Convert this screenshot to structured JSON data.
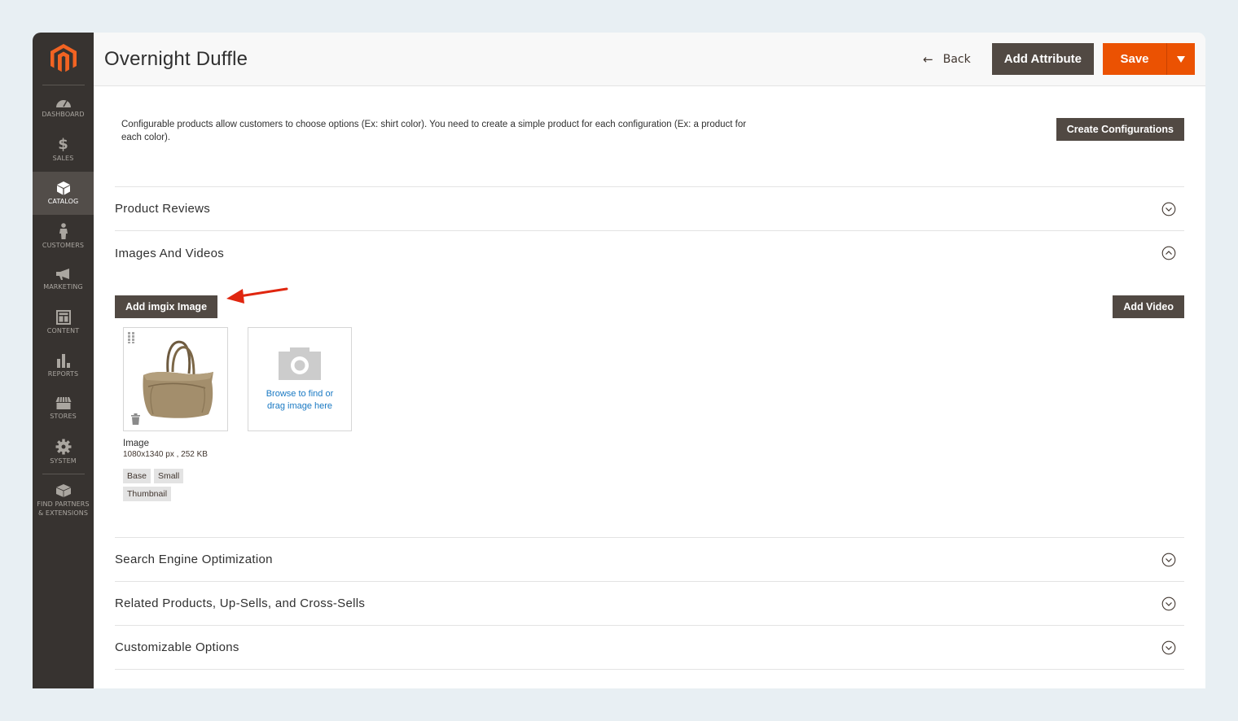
{
  "sidebar": {
    "logo": "magento-logo",
    "items": [
      {
        "label": "Dashboard",
        "icon": "dashboard-icon",
        "active": false
      },
      {
        "label": "Sales",
        "icon": "dollar-icon",
        "active": false
      },
      {
        "label": "Catalog",
        "icon": "box-icon",
        "active": true
      },
      {
        "label": "Customers",
        "icon": "person-icon",
        "active": false
      },
      {
        "label": "Marketing",
        "icon": "megaphone-icon",
        "active": false
      },
      {
        "label": "Content",
        "icon": "layout-icon",
        "active": false
      },
      {
        "label": "Reports",
        "icon": "bar-chart-icon",
        "active": false
      },
      {
        "label": "Stores",
        "icon": "storefront-icon",
        "active": false
      },
      {
        "label": "System",
        "icon": "gear-icon",
        "active": false
      }
    ],
    "partners": {
      "line1": "Find Partners",
      "line2": "& Extensions",
      "icon": "cube-icon"
    }
  },
  "header": {
    "title": "Overnight Duffle",
    "back_label": "Back",
    "add_attribute_label": "Add Attribute",
    "save_label": "Save"
  },
  "config": {
    "text": "Configurable products allow customers to choose options (Ex: shirt color). You need to create a simple product for each configuration (Ex: a product for each color).",
    "button_label": "Create Configurations"
  },
  "sections": {
    "product_reviews": "Product Reviews",
    "images_and_videos": "Images And Videos",
    "seo": "Search Engine Optimization",
    "related": "Related Products, Up-Sells, and Cross-Sells",
    "customizable": "Customizable Options"
  },
  "images": {
    "add_imgix_label": "Add imgix Image",
    "add_video_label": "Add Video",
    "uploader_text_line1": "Browse to find or",
    "uploader_text_line2": "drag image here",
    "item": {
      "name": "Image",
      "size": "1080x1340 px , 252 KB",
      "roles": [
        "Base",
        "Small",
        "Thumbnail"
      ]
    }
  },
  "colors": {
    "accent": "#eb5202",
    "dark_button": "#514943",
    "sidebar_bg": "#373330",
    "link": "#1979c3",
    "annotation_arrow": "#e0260f"
  }
}
